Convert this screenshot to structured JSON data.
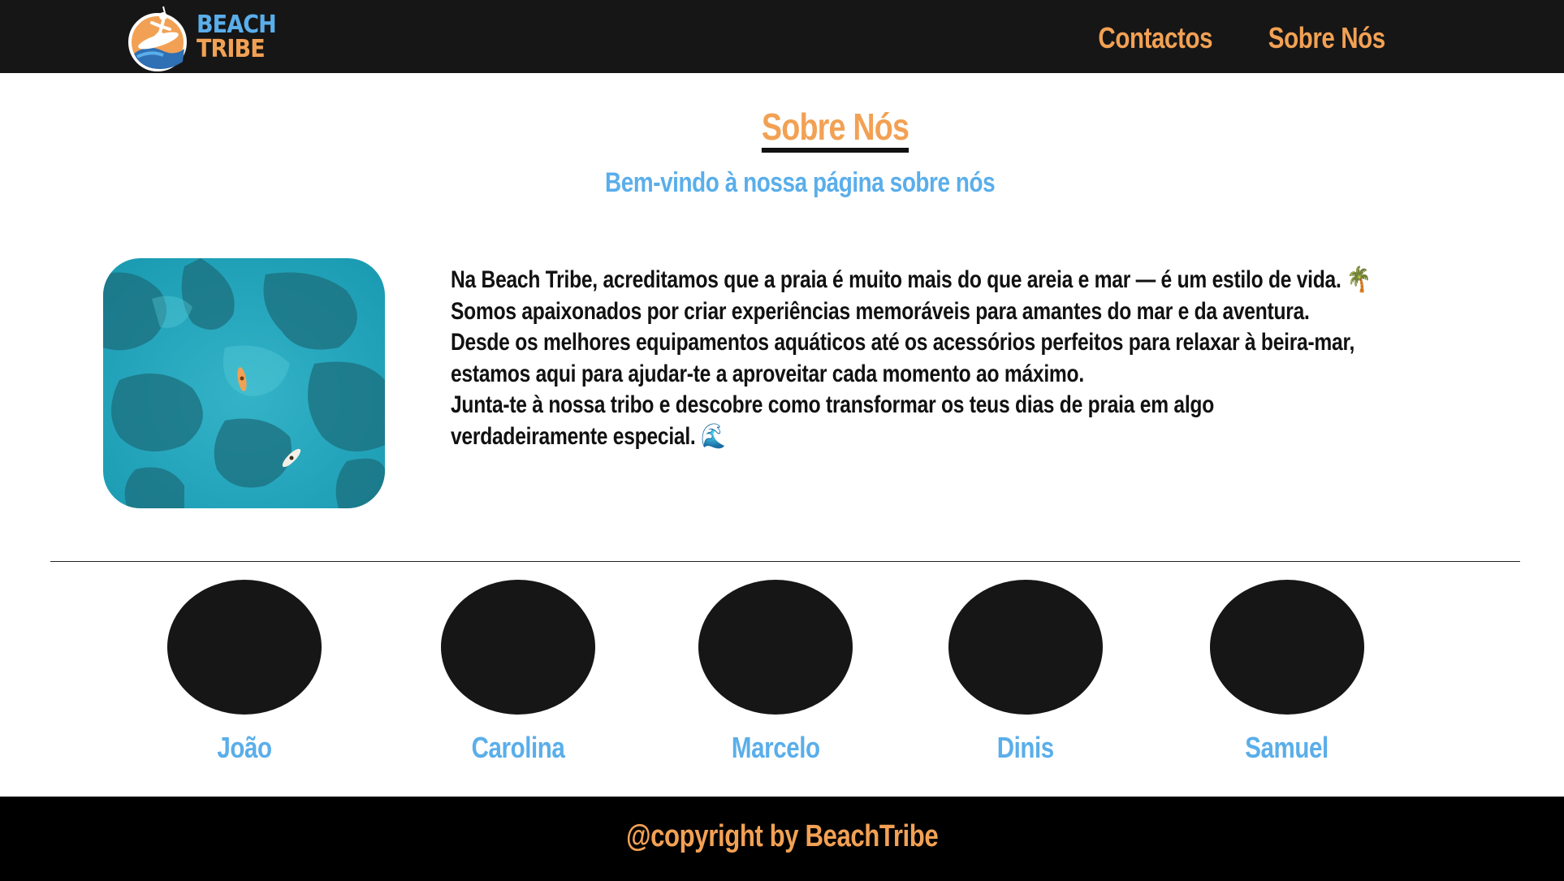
{
  "brand": {
    "line1": "BEACH",
    "line2": "TRIBE",
    "icon": "surfer-logo-icon",
    "colors": {
      "blue": "#5aaeea",
      "orange": "#f2a154",
      "dark": "#161616"
    }
  },
  "nav": {
    "links": [
      {
        "label": "Contactos"
      },
      {
        "label": "Sobre Nós"
      }
    ]
  },
  "page": {
    "title": "Sobre Nós",
    "subtitle": "Bem-vindo à nossa página sobre nós"
  },
  "about": {
    "image": "aerial-ocean-kayaks-photo",
    "lines": [
      "Na Beach Tribe, acreditamos que a praia é muito mais do que areia e mar — é um estilo de vida. 🌴",
      "Somos apaixonados por criar experiências memoráveis para amantes do mar e da aventura.",
      "Desde os melhores equipamentos aquáticos até os acessórios perfeitos para relaxar à beira-mar,",
      "estamos aqui para ajudar-te a aproveitar cada momento ao máximo.",
      "Junta-te à nossa tribo e descobre como transformar os teus dias de praia em algo",
      "verdadeiramente especial. 🌊"
    ]
  },
  "team": [
    {
      "name": "João"
    },
    {
      "name": "Carolina"
    },
    {
      "name": "Marcelo"
    },
    {
      "name": "Dinis"
    },
    {
      "name": "Samuel"
    }
  ],
  "footer": {
    "text": "@copyright by BeachTribe"
  }
}
